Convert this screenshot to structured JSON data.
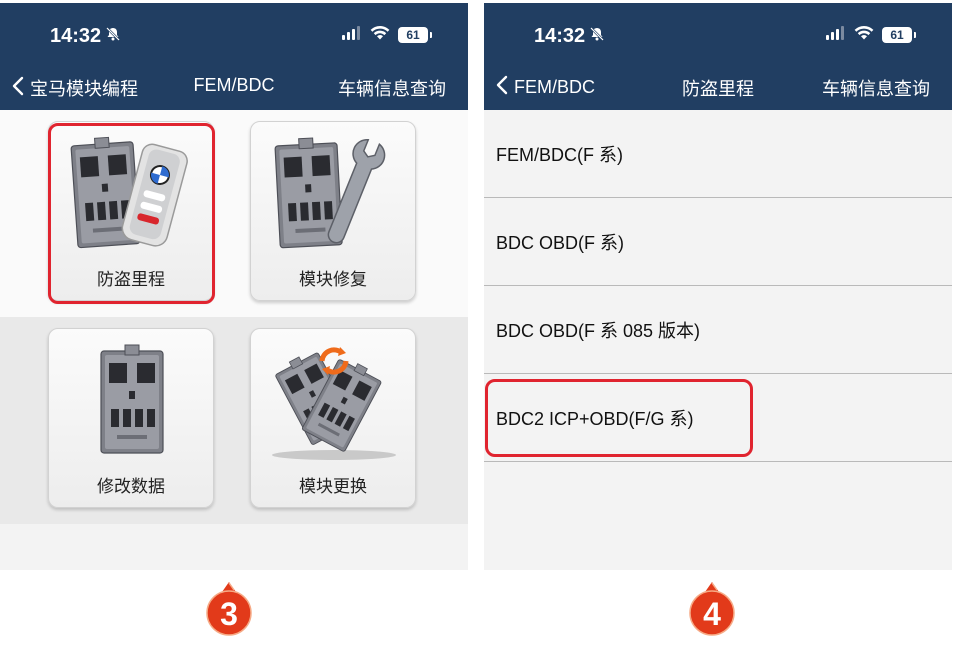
{
  "left_screen": {
    "status": {
      "time": "14:32",
      "battery": "61"
    },
    "nav": {
      "back_label": "宝马模块编程",
      "title": "FEM/BDC",
      "right_label": "车辆信息查询"
    },
    "tiles": [
      {
        "label": "防盗里程",
        "icon": "fem-bdc-module-with-key-icon"
      },
      {
        "label": "模块修复",
        "icon": "fem-bdc-module-with-wrench-icon"
      },
      {
        "label": "修改数据",
        "icon": "fem-bdc-module-icon"
      },
      {
        "label": "模块更换",
        "icon": "module-swap-icon"
      }
    ]
  },
  "right_screen": {
    "status": {
      "time": "14:32",
      "battery": "61"
    },
    "nav": {
      "back_label": "FEM/BDC",
      "title": "防盗里程",
      "right_label": "车辆信息查询"
    },
    "items": [
      {
        "label": "FEM/BDC(F 系)"
      },
      {
        "label": "BDC OBD(F 系)"
      },
      {
        "label": "BDC OBD(F 系 085 版本)"
      },
      {
        "label": "BDC2 ICP+OBD(F/G 系)"
      }
    ]
  },
  "steps": [
    {
      "number": "3"
    },
    {
      "number": "4"
    }
  ],
  "colors": {
    "nav_bar": "#213e62",
    "highlight": "#e0242f",
    "badge": "#e23a1a",
    "list_background": "#f3f3f3"
  }
}
